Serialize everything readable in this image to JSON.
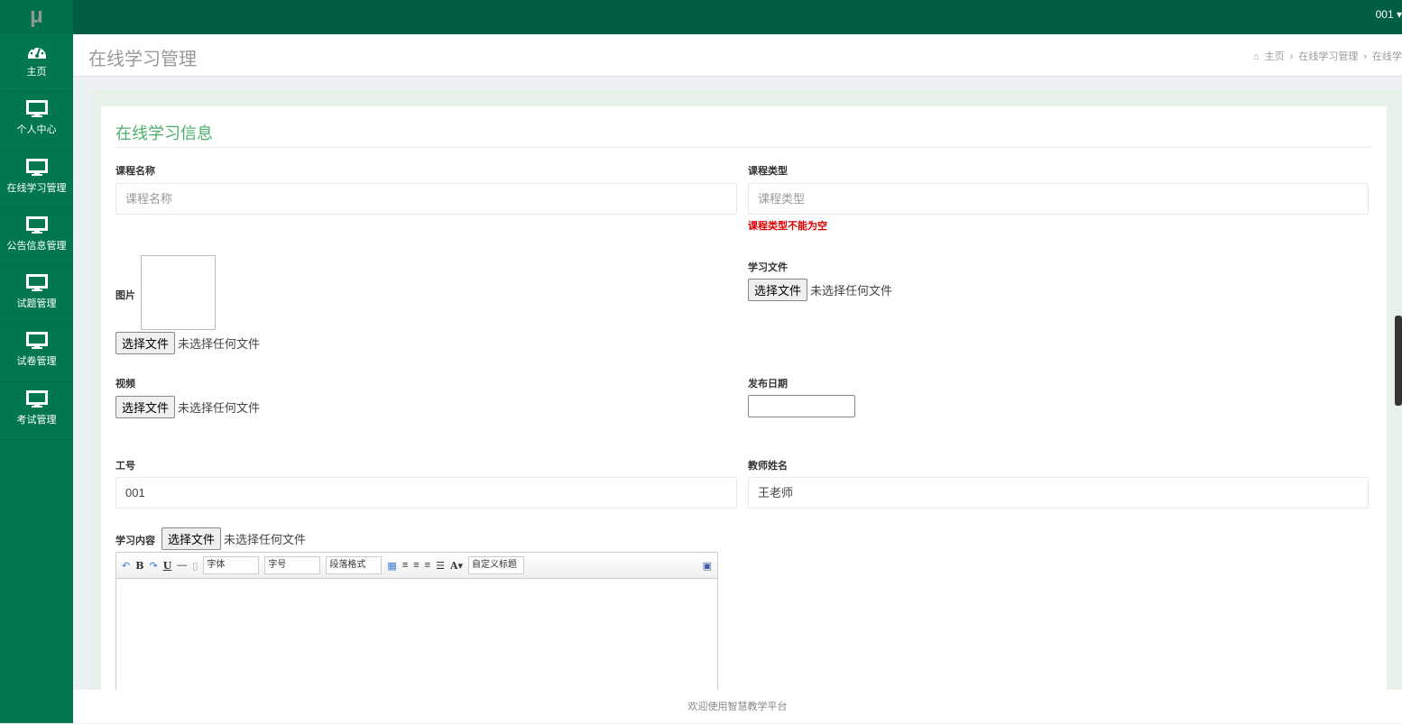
{
  "app": {
    "logo": "μ",
    "user": "001 ▾"
  },
  "sidebar": {
    "items": [
      {
        "label": "主页",
        "icon": "dashboard-icon"
      },
      {
        "label": "个人中心",
        "icon": "monitor-icon"
      },
      {
        "label": "在线学习管理",
        "icon": "monitor-icon"
      },
      {
        "label": "公告信息管理",
        "icon": "monitor-icon"
      },
      {
        "label": "试题管理",
        "icon": "monitor-icon"
      },
      {
        "label": "试卷管理",
        "icon": "monitor-icon"
      },
      {
        "label": "考试管理",
        "icon": "monitor-icon"
      }
    ]
  },
  "header": {
    "title": "在线学习管理",
    "breadcrumb": [
      "主页",
      "在线学习管理",
      "在线学"
    ]
  },
  "form": {
    "title": "在线学习信息",
    "course_name": {
      "label": "课程名称",
      "placeholder": "课程名称"
    },
    "course_type": {
      "label": "课程类型",
      "placeholder": "课程类型",
      "error": "课程类型不能为空"
    },
    "image": {
      "label": "图片"
    },
    "study_file": {
      "label": "学习文件"
    },
    "video": {
      "label": "视频"
    },
    "publish_date": {
      "label": "发布日期"
    },
    "job_no": {
      "label": "工号",
      "value": "001"
    },
    "teacher": {
      "label": "教师姓名",
      "value": "王老师"
    },
    "content": {
      "label": "学习内容"
    },
    "file_button": "选择文件",
    "no_file": "未选择任何文件"
  },
  "editor": {
    "font": "字体",
    "size": "字号",
    "paragraph": "段落格式",
    "custom_title": "自定义标题"
  },
  "footer": "欢迎使用智慧教学平台"
}
